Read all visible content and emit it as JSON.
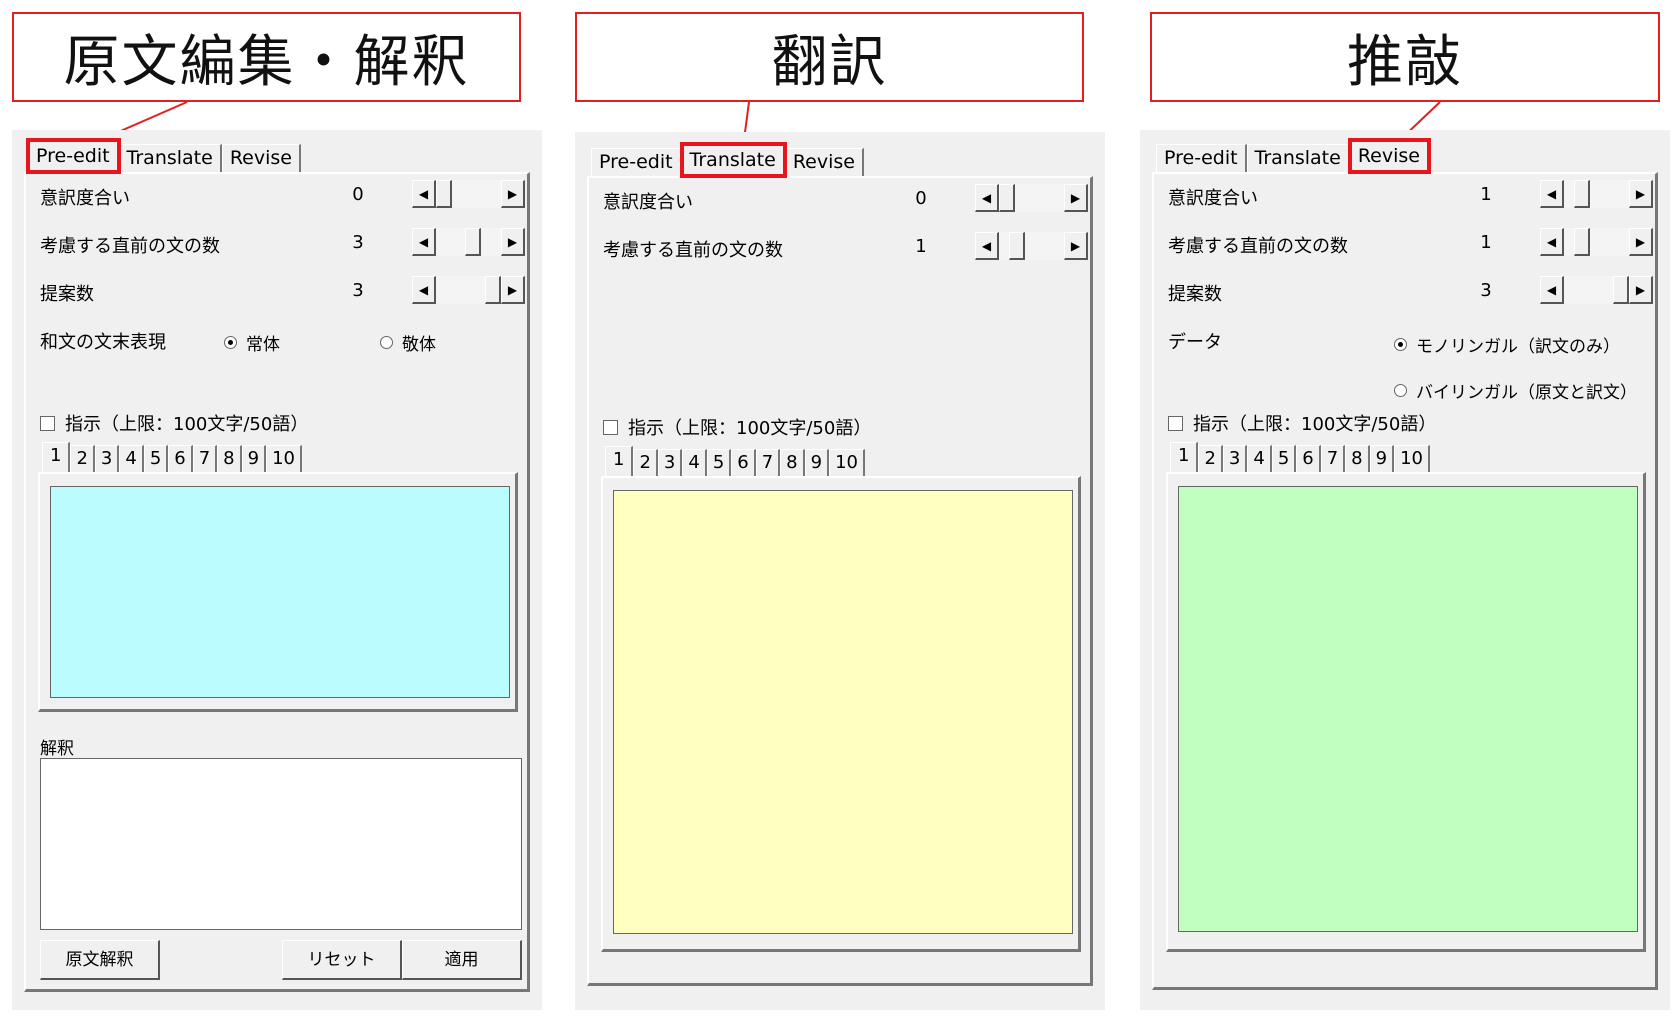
{
  "callouts": {
    "preedit": "原文編集・解釈",
    "translate": "翻訳",
    "revise": "推敲"
  },
  "tabs": [
    "Pre-edit",
    "Translate",
    "Revise"
  ],
  "number_tabs": [
    "1",
    "2",
    "3",
    "4",
    "5",
    "6",
    "7",
    "8",
    "9",
    "10"
  ],
  "preedit": {
    "freedom_label": "意訳度合い",
    "freedom_value": "0",
    "freedom_level": 0.0,
    "context_label": "考慮する直前の文の数",
    "context_value": "3",
    "context_level": 0.6,
    "proposals_label": "提案数",
    "proposals_value": "3",
    "proposals_level": 1.0,
    "ending_label": "和文の文末表現",
    "ending_options": [
      "常体",
      "敬体"
    ],
    "instruction_label": "指示（上限：100文字/50語）",
    "interpretation_label": "解釈",
    "btn_interpret": "原文解釈",
    "btn_reset": "リセット",
    "btn_apply": "適用",
    "editor_color": "#bbfdff"
  },
  "translate": {
    "freedom_label": "意訳度合い",
    "freedom_value": "0",
    "freedom_level": 0.0,
    "context_label": "考慮する直前の文の数",
    "context_value": "1",
    "context_level": 0.2,
    "instruction_label": "指示（上限：100文字/50語）",
    "editor_color": "#ffffc0"
  },
  "revise": {
    "freedom_label": "意訳度合い",
    "freedom_value": "1",
    "freedom_level": 0.2,
    "context_label": "考慮する直前の文の数",
    "context_value": "1",
    "context_level": 0.2,
    "proposals_label": "提案数",
    "proposals_value": "3",
    "proposals_level": 1.0,
    "data_label": "データ",
    "data_options": [
      "モノリンガル（訳文のみ）",
      "バイリンガル（原文と訳文）"
    ],
    "instruction_label": "指示（上限：100文字/50語）",
    "editor_color": "#c0ffc0"
  },
  "colors": {
    "highlight": "#e8141e",
    "panel": "#f0f0f0"
  }
}
